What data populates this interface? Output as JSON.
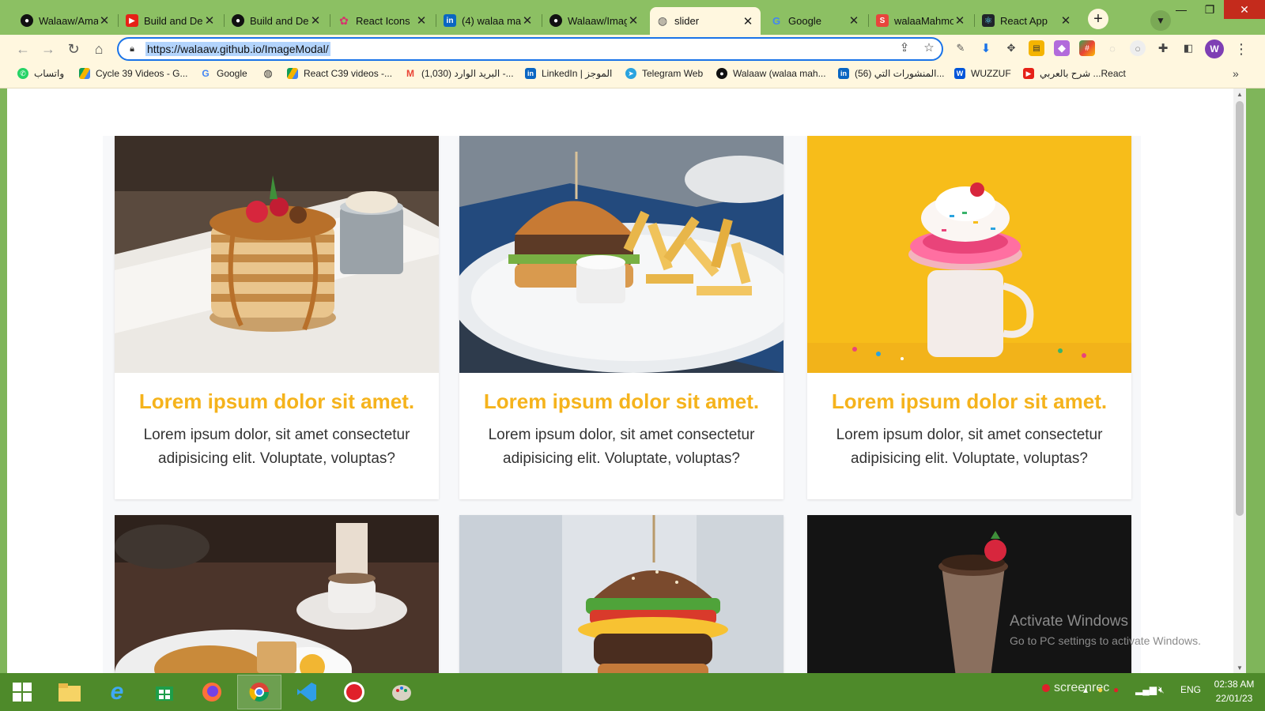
{
  "browser": {
    "tabs": [
      {
        "label": "Walaaw/Ama",
        "icon": "github-icon",
        "active": false
      },
      {
        "label": "Build and De",
        "icon": "youtube-icon",
        "active": false
      },
      {
        "label": "Build and De",
        "icon": "github-icon",
        "active": false
      },
      {
        "label": "React Icons",
        "icon": "react-icons-icon",
        "active": false
      },
      {
        "label": "(4) walaa ma",
        "icon": "linkedin-icon",
        "active": false
      },
      {
        "label": "Walaaw/Imag",
        "icon": "github-icon",
        "active": false
      },
      {
        "label": "slider",
        "icon": "globe-icon",
        "active": true
      },
      {
        "label": "Google",
        "icon": "google-icon",
        "active": false
      },
      {
        "label": "walaaMahmo",
        "icon": "s-logo-icon",
        "active": false
      },
      {
        "label": "React App",
        "icon": "react-icon",
        "active": false
      }
    ],
    "url": "https://walaaw.github.io/ImageModal/",
    "profile_initial": "W",
    "bookmarks": [
      {
        "label": "واتساب",
        "icon": "whatsapp-icon"
      },
      {
        "label": "Cycle 39 Videos - G...",
        "icon": "drive-icon"
      },
      {
        "label": "Google",
        "icon": "google-icon"
      },
      {
        "label": "",
        "icon": "globe-icon"
      },
      {
        "label": "React C39 videos -...",
        "icon": "drive-icon"
      },
      {
        "label": "البريد الوارد (1,030) -...",
        "icon": "gmail-icon"
      },
      {
        "label": "LinkedIn | الموجز",
        "icon": "linkedin-icon"
      },
      {
        "label": "Telegram Web",
        "icon": "telegram-icon"
      },
      {
        "label": "Walaaw (walaa mah...",
        "icon": "github-icon"
      },
      {
        "label": "(56) المنشورات التي...",
        "icon": "linkedin-icon"
      },
      {
        "label": "WUZZUF",
        "icon": "wuzzuf-icon"
      },
      {
        "label": "شرح بالعربي ...React",
        "icon": "youtube-icon"
      }
    ]
  },
  "page": {
    "cards": [
      {
        "title": "Lorem ipsum dolor sit amet.",
        "text": "Lorem ipsum dolor, sit amet consectetur adipisicing elit. Voluptate, voluptas?",
        "image": "pancakes-photo"
      },
      {
        "title": "Lorem ipsum dolor sit amet.",
        "text": "Lorem ipsum dolor, sit amet consectetur adipisicing elit. Voluptate, voluptas?",
        "image": "burger-fries-photo"
      },
      {
        "title": "Lorem ipsum dolor sit amet.",
        "text": "Lorem ipsum dolor, sit amet consectetur adipisicing elit. Voluptate, voluptas?",
        "image": "milkshake-donut-photo"
      },
      {
        "image": "breakfast-photo"
      },
      {
        "image": "egg-burger-photo"
      },
      {
        "image": "chocolate-shake-photo"
      }
    ],
    "accent_color": "#f5b31c"
  },
  "watermark": {
    "line1": "Activate Windows",
    "line2": "Go to PC settings to activate Windows."
  },
  "taskbar": {
    "tray_label": "screenrec",
    "language": "ENG",
    "time": "02:38 AM",
    "date": "22/01/23"
  }
}
